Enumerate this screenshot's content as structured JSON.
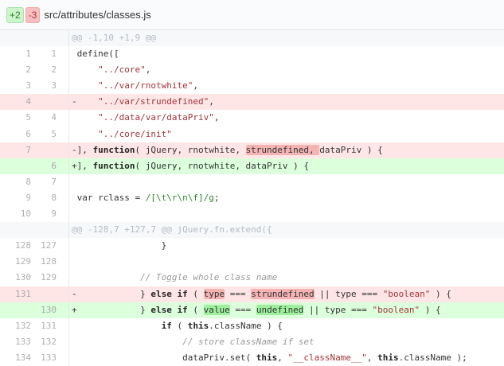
{
  "file": {
    "additions": "+2",
    "deletions": "-3",
    "path": "src/attributes/classes.js"
  },
  "colors": {
    "del_bg": "#ffe6e6",
    "add_bg": "#dcffdc",
    "del_word": "#f5b3b3",
    "add_word": "#9eef9e"
  },
  "rows": [
    {
      "type": "hunk",
      "old": "",
      "new": "",
      "tokens": [
        [
          "@@ -1,10 +1,9 @@",
          ""
        ]
      ]
    },
    {
      "type": "ctx",
      "old": "1",
      "new": "1",
      "tokens": [
        [
          " define([",
          ""
        ]
      ]
    },
    {
      "type": "ctx",
      "old": "2",
      "new": "2",
      "tokens": [
        [
          "     ",
          ""
        ],
        [
          "\"../core\"",
          "s"
        ],
        [
          ",",
          ""
        ]
      ]
    },
    {
      "type": "ctx",
      "old": "3",
      "new": "3",
      "tokens": [
        [
          "     ",
          ""
        ],
        [
          "\"../var/rnotwhite\"",
          "s"
        ],
        [
          ",",
          ""
        ]
      ]
    },
    {
      "type": "del",
      "old": "4",
      "new": "",
      "tokens": [
        [
          "-    ",
          ""
        ],
        [
          "\"../var/strundefined\"",
          "s"
        ],
        [
          ",",
          ""
        ]
      ]
    },
    {
      "type": "ctx",
      "old": "5",
      "new": "4",
      "tokens": [
        [
          "     ",
          ""
        ],
        [
          "\"../data/var/dataPriv\"",
          "s"
        ],
        [
          ",",
          ""
        ]
      ]
    },
    {
      "type": "ctx",
      "old": "6",
      "new": "5",
      "tokens": [
        [
          "     ",
          ""
        ],
        [
          "\"../core/init\"",
          "s"
        ]
      ]
    },
    {
      "type": "del",
      "old": "7",
      "new": "",
      "tokens": [
        [
          "-], ",
          ""
        ],
        [
          "function",
          "k"
        ],
        [
          "( jQuery, rnotwhite, ",
          ""
        ],
        [
          "strundefined, ",
          "hd"
        ],
        [
          "dataPriv ) {",
          ""
        ]
      ]
    },
    {
      "type": "add",
      "old": "",
      "new": "6",
      "tokens": [
        [
          "+], ",
          ""
        ],
        [
          "function",
          "k"
        ],
        [
          "( jQuery, rnotwhite, dataPriv ) {",
          ""
        ]
      ]
    },
    {
      "type": "ctx",
      "old": "8",
      "new": "7",
      "tokens": [
        [
          "",
          ""
        ]
      ]
    },
    {
      "type": "ctx",
      "old": "9",
      "new": "8",
      "tokens": [
        [
          " var rclass = ",
          ""
        ],
        [
          "/[\\t\\r\\n\\f]/g",
          "r"
        ],
        [
          ";",
          ""
        ]
      ]
    },
    {
      "type": "ctx",
      "old": "10",
      "new": "9",
      "tokens": [
        [
          "",
          ""
        ]
      ]
    },
    {
      "type": "hunk",
      "old": "",
      "new": "",
      "tokens": [
        [
          "@@ -128,7 +127,7 @@ jQuery.fn.extend({",
          ""
        ]
      ]
    },
    {
      "type": "ctx",
      "old": "128",
      "new": "127",
      "tokens": [
        [
          "                 }",
          ""
        ]
      ]
    },
    {
      "type": "ctx",
      "old": "129",
      "new": "128",
      "tokens": [
        [
          "",
          ""
        ]
      ]
    },
    {
      "type": "ctx",
      "old": "130",
      "new": "129",
      "tokens": [
        [
          "             ",
          ""
        ],
        [
          "// Toggle whole class name",
          "c"
        ]
      ]
    },
    {
      "type": "del",
      "old": "131",
      "new": "",
      "tokens": [
        [
          "-            } ",
          ""
        ],
        [
          "else if",
          "k"
        ],
        [
          " ( ",
          ""
        ],
        [
          "type",
          "hd"
        ],
        [
          " === ",
          ""
        ],
        [
          "strundefined",
          "hd"
        ],
        [
          " || type === ",
          ""
        ],
        [
          "\"boolean\"",
          "s"
        ],
        [
          " ) {",
          ""
        ]
      ]
    },
    {
      "type": "add",
      "old": "",
      "new": "130",
      "tokens": [
        [
          "+            } ",
          ""
        ],
        [
          "else if",
          "k"
        ],
        [
          " ( ",
          ""
        ],
        [
          "value",
          "ha"
        ],
        [
          " === ",
          ""
        ],
        [
          "undefined",
          "ha"
        ],
        [
          " || type === ",
          ""
        ],
        [
          "\"boolean\"",
          "s"
        ],
        [
          " ) {",
          ""
        ]
      ]
    },
    {
      "type": "ctx",
      "old": "132",
      "new": "131",
      "tokens": [
        [
          "                 ",
          ""
        ],
        [
          "if",
          "k"
        ],
        [
          " ( ",
          ""
        ],
        [
          "this",
          "k"
        ],
        [
          ".className ) {",
          ""
        ]
      ]
    },
    {
      "type": "ctx",
      "old": "133",
      "new": "132",
      "tokens": [
        [
          "                     ",
          ""
        ],
        [
          "// store className if set",
          "c"
        ]
      ]
    },
    {
      "type": "ctx",
      "old": "134",
      "new": "133",
      "tokens": [
        [
          "                     dataPriv.set( ",
          ""
        ],
        [
          "this",
          "k"
        ],
        [
          ", ",
          ""
        ],
        [
          "\"__className__\"",
          "s"
        ],
        [
          ", ",
          ""
        ],
        [
          "this",
          "k"
        ],
        [
          ".className );",
          ""
        ]
      ]
    }
  ]
}
